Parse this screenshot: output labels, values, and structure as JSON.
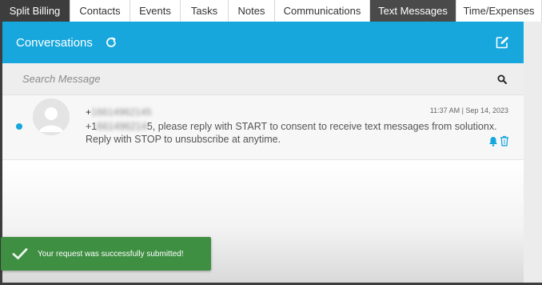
{
  "tabs": [
    {
      "label": "Split Billing"
    },
    {
      "label": "Contacts"
    },
    {
      "label": "Events"
    },
    {
      "label": "Tasks"
    },
    {
      "label": "Notes"
    },
    {
      "label": "Communications"
    },
    {
      "label": "Text Messages"
    },
    {
      "label": "Time/Expenses"
    }
  ],
  "conversations": {
    "title": "Conversations",
    "search_placeholder": "Search Message"
  },
  "message": {
    "sender_prefix": "+",
    "sender_number": "16614962145",
    "timestamp": "11:37 AM | Sep 14, 2023",
    "body_prefix": "+1",
    "body_number": "661496214",
    "body_text": "5, please reply with START to consent to receive text messages from solutionx. Reply with STOP to unsubscribe at anytime."
  },
  "toast": {
    "text": "Your request was successfully submitted!"
  },
  "colors": {
    "header": "#17a7dd",
    "toast": "#3f8f43",
    "unread_dot": "#17a7dd"
  }
}
